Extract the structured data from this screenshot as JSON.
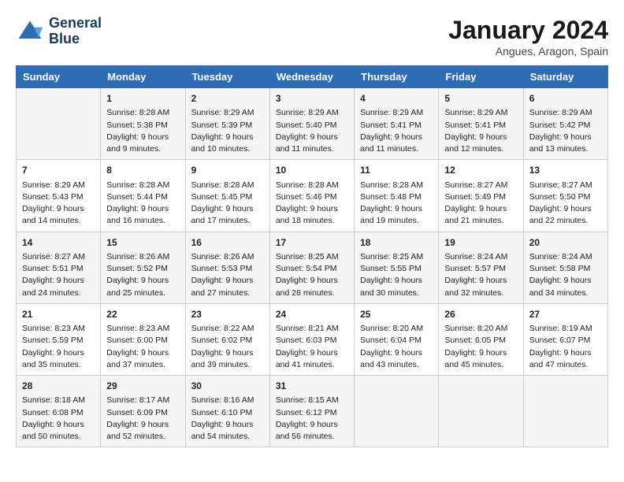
{
  "header": {
    "logo_line1": "General",
    "logo_line2": "Blue",
    "title": "January 2024",
    "subtitle": "Angues, Aragon, Spain"
  },
  "days_of_week": [
    "Sunday",
    "Monday",
    "Tuesday",
    "Wednesday",
    "Thursday",
    "Friday",
    "Saturday"
  ],
  "weeks": [
    [
      {
        "day": "",
        "info": ""
      },
      {
        "day": "1",
        "info": "Sunrise: 8:28 AM\nSunset: 5:38 PM\nDaylight: 9 hours\nand 9 minutes."
      },
      {
        "day": "2",
        "info": "Sunrise: 8:29 AM\nSunset: 5:39 PM\nDaylight: 9 hours\nand 10 minutes."
      },
      {
        "day": "3",
        "info": "Sunrise: 8:29 AM\nSunset: 5:40 PM\nDaylight: 9 hours\nand 11 minutes."
      },
      {
        "day": "4",
        "info": "Sunrise: 8:29 AM\nSunset: 5:41 PM\nDaylight: 9 hours\nand 11 minutes."
      },
      {
        "day": "5",
        "info": "Sunrise: 8:29 AM\nSunset: 5:41 PM\nDaylight: 9 hours\nand 12 minutes."
      },
      {
        "day": "6",
        "info": "Sunrise: 8:29 AM\nSunset: 5:42 PM\nDaylight: 9 hours\nand 13 minutes."
      }
    ],
    [
      {
        "day": "7",
        "info": "Sunrise: 8:29 AM\nSunset: 5:43 PM\nDaylight: 9 hours\nand 14 minutes."
      },
      {
        "day": "8",
        "info": "Sunrise: 8:28 AM\nSunset: 5:44 PM\nDaylight: 9 hours\nand 16 minutes."
      },
      {
        "day": "9",
        "info": "Sunrise: 8:28 AM\nSunset: 5:45 PM\nDaylight: 9 hours\nand 17 minutes."
      },
      {
        "day": "10",
        "info": "Sunrise: 8:28 AM\nSunset: 5:46 PM\nDaylight: 9 hours\nand 18 minutes."
      },
      {
        "day": "11",
        "info": "Sunrise: 8:28 AM\nSunset: 5:48 PM\nDaylight: 9 hours\nand 19 minutes."
      },
      {
        "day": "12",
        "info": "Sunrise: 8:27 AM\nSunset: 5:49 PM\nDaylight: 9 hours\nand 21 minutes."
      },
      {
        "day": "13",
        "info": "Sunrise: 8:27 AM\nSunset: 5:50 PM\nDaylight: 9 hours\nand 22 minutes."
      }
    ],
    [
      {
        "day": "14",
        "info": "Sunrise: 8:27 AM\nSunset: 5:51 PM\nDaylight: 9 hours\nand 24 minutes."
      },
      {
        "day": "15",
        "info": "Sunrise: 8:26 AM\nSunset: 5:52 PM\nDaylight: 9 hours\nand 25 minutes."
      },
      {
        "day": "16",
        "info": "Sunrise: 8:26 AM\nSunset: 5:53 PM\nDaylight: 9 hours\nand 27 minutes."
      },
      {
        "day": "17",
        "info": "Sunrise: 8:25 AM\nSunset: 5:54 PM\nDaylight: 9 hours\nand 28 minutes."
      },
      {
        "day": "18",
        "info": "Sunrise: 8:25 AM\nSunset: 5:55 PM\nDaylight: 9 hours\nand 30 minutes."
      },
      {
        "day": "19",
        "info": "Sunrise: 8:24 AM\nSunset: 5:57 PM\nDaylight: 9 hours\nand 32 minutes."
      },
      {
        "day": "20",
        "info": "Sunrise: 8:24 AM\nSunset: 5:58 PM\nDaylight: 9 hours\nand 34 minutes."
      }
    ],
    [
      {
        "day": "21",
        "info": "Sunrise: 8:23 AM\nSunset: 5:59 PM\nDaylight: 9 hours\nand 35 minutes."
      },
      {
        "day": "22",
        "info": "Sunrise: 8:23 AM\nSunset: 6:00 PM\nDaylight: 9 hours\nand 37 minutes."
      },
      {
        "day": "23",
        "info": "Sunrise: 8:22 AM\nSunset: 6:02 PM\nDaylight: 9 hours\nand 39 minutes."
      },
      {
        "day": "24",
        "info": "Sunrise: 8:21 AM\nSunset: 6:03 PM\nDaylight: 9 hours\nand 41 minutes."
      },
      {
        "day": "25",
        "info": "Sunrise: 8:20 AM\nSunset: 6:04 PM\nDaylight: 9 hours\nand 43 minutes."
      },
      {
        "day": "26",
        "info": "Sunrise: 8:20 AM\nSunset: 6:05 PM\nDaylight: 9 hours\nand 45 minutes."
      },
      {
        "day": "27",
        "info": "Sunrise: 8:19 AM\nSunset: 6:07 PM\nDaylight: 9 hours\nand 47 minutes."
      }
    ],
    [
      {
        "day": "28",
        "info": "Sunrise: 8:18 AM\nSunset: 6:08 PM\nDaylight: 9 hours\nand 50 minutes."
      },
      {
        "day": "29",
        "info": "Sunrise: 8:17 AM\nSunset: 6:09 PM\nDaylight: 9 hours\nand 52 minutes."
      },
      {
        "day": "30",
        "info": "Sunrise: 8:16 AM\nSunset: 6:10 PM\nDaylight: 9 hours\nand 54 minutes."
      },
      {
        "day": "31",
        "info": "Sunrise: 8:15 AM\nSunset: 6:12 PM\nDaylight: 9 hours\nand 56 minutes."
      },
      {
        "day": "",
        "info": ""
      },
      {
        "day": "",
        "info": ""
      },
      {
        "day": "",
        "info": ""
      }
    ]
  ]
}
